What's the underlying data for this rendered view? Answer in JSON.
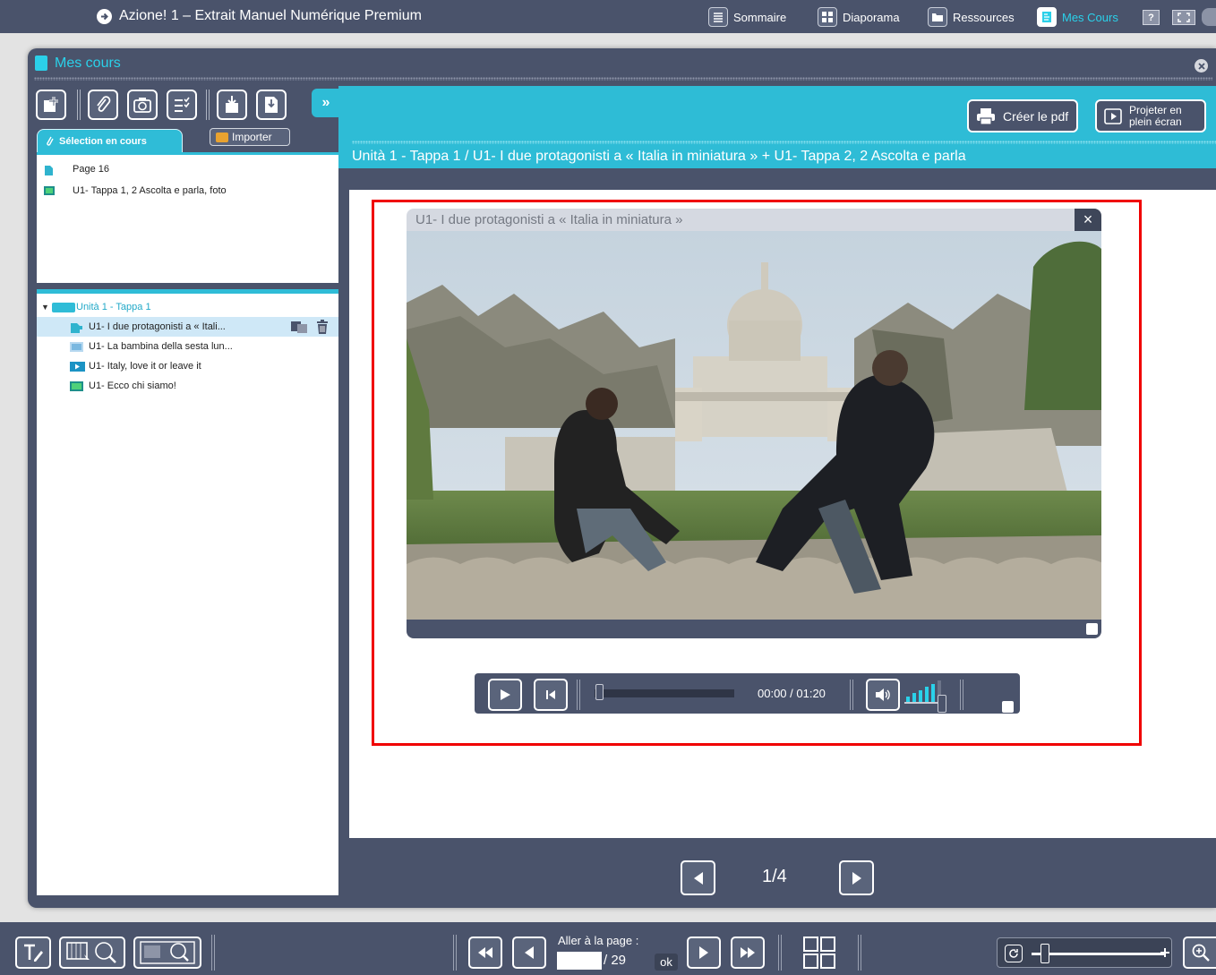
{
  "app": {
    "title": "Azione! 1 – Extrait Manuel Numérique Premium"
  },
  "topnav": {
    "items": [
      {
        "label": "Sommaire",
        "icon": "list-icon"
      },
      {
        "label": "Diaporama",
        "icon": "grid-icon"
      },
      {
        "label": "Ressources",
        "icon": "folder-icon"
      },
      {
        "label": "Mes Cours",
        "icon": "course-icon"
      }
    ],
    "help": "?"
  },
  "panel": {
    "title": "Mes cours"
  },
  "left": {
    "tab_label": "Sélection en cours",
    "import_label": "Importer",
    "selection": [
      {
        "label": "Page 16",
        "icon": "page-icon"
      },
      {
        "label": "U1- Tappa 1, 2 Ascolta e parla, foto",
        "icon": "image-icon"
      }
    ],
    "tree": {
      "root": "Unità 1 - Tappa 1",
      "items": [
        {
          "label": "U1- I due protagonisti a « Itali...",
          "icon": "video-page-icon"
        },
        {
          "label": "U1- La bambina della sesta lun...",
          "icon": "image-icon"
        },
        {
          "label": "U1- Italy, love it or leave it",
          "icon": "video-icon"
        },
        {
          "label": "U1- Ecco chi siamo!",
          "icon": "image-icon"
        }
      ]
    }
  },
  "header": {
    "pdf_button": "Créer le pdf",
    "project_button_line1": "Projeter en",
    "project_button_line2": "plein écran",
    "breadcrumb": "Unità 1 - Tappa 1 / U1- I due protagonisti a « Italia in miniatura » + U1- Tappa 2, 2 Ascolta e parla"
  },
  "video": {
    "title": "U1- I due protagonisti a « Italia in miniatura »",
    "close": "×",
    "time": "00:00 / 01:20",
    "volume_level": 0.85,
    "progress": 0
  },
  "pager": {
    "counter": "1/4"
  },
  "bottom": {
    "goto_label": "Aller à la page :",
    "goto_value": "",
    "goto_total": "/ 29",
    "ok_label": "ok"
  },
  "colors": {
    "chrome": "#4a536b",
    "accent": "#2ebcd6",
    "highlight_frame": "#f00000"
  }
}
